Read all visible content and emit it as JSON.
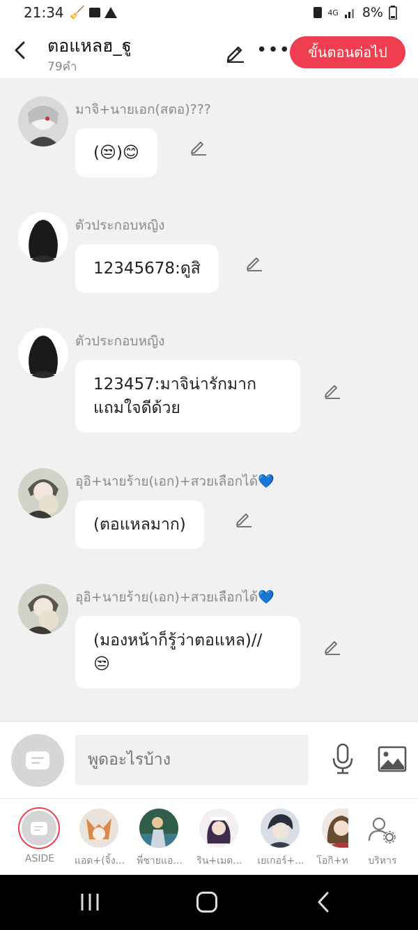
{
  "status_bar": {
    "time": "21:34",
    "network": "4G",
    "battery": "8%"
  },
  "header": {
    "title": "ตอแหลฮ_ฐู",
    "word_count": "79คำ",
    "next_label": "ขั้นตอนต่อไป"
  },
  "messages": [
    {
      "name": "มาจิ+นายเอก(สตอ)???",
      "text": "(😒)😊"
    },
    {
      "name": "ตัวประกอบหญิง",
      "text": "12345678:ดูสิ"
    },
    {
      "name": "ตัวประกอบหญิง",
      "line1": "123457:มาจิน่ารักมาก",
      "line2": "แถมใจดีด้วย"
    },
    {
      "name": "อุอิ+นายร้าย(เอก)+สวยเลือกได้💙",
      "text": "(ตอแหลมาก)"
    },
    {
      "name": "อุอิ+นายร้าย(เอก)+สวยเลือกได้💙",
      "line1": "(มองหน้าก็รู้ว่าตอแหล)//",
      "line2": "😒"
    }
  ],
  "composer": {
    "placeholder": "พูดอะไรบ้าง"
  },
  "tabs": [
    {
      "label": "ASIDE"
    },
    {
      "label": "แอด+(จิ้ง..."
    },
    {
      "label": "พี่ชายแอ..."
    },
    {
      "label": "ริน+เมด..."
    },
    {
      "label": "เยเกอร์+..."
    },
    {
      "label": "โอกิ+ท"
    },
    {
      "label": "บริหาร"
    }
  ],
  "colors": {
    "accent": "#ef3e4f",
    "background": "#f1f1f1",
    "bubble": "#ffffff"
  }
}
